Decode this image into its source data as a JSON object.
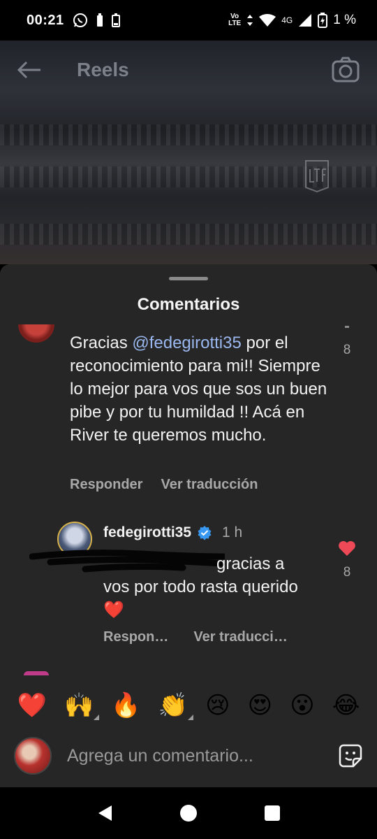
{
  "status_bar": {
    "time": "00:21",
    "network_top": "Vo",
    "network_bottom": "LTE",
    "signal_label": "4G",
    "battery_percent": "1 %"
  },
  "reels": {
    "title": "Reels"
  },
  "sheet": {
    "title": "Comentarios"
  },
  "comment": {
    "text_before_mention": "Gracias ",
    "mention": "@fedegirotti35",
    "text_after_mention": " por el reconocimiento para mi!! Siempre  lo mejor para vos que  sos un buen pibe y por tu humildad !! Acá en River te queremos mucho.",
    "like_count": "8",
    "reply_label": "Responder",
    "translate_label": "Ver traducción"
  },
  "reply": {
    "username": "fedegirotti35",
    "time": "1 h",
    "text_line1": "gracias a",
    "text_rest": "vos por todo rasta querido",
    "heart_emoji": "❤️",
    "like_count": "8",
    "reply_label": "Respon…",
    "translate_label": "Ver traducci…"
  },
  "emoji_bar": [
    "❤️",
    "🙌",
    "🔥",
    "👏",
    "😢",
    "😍",
    "😮",
    "😂"
  ],
  "input": {
    "placeholder": "Agrega un comentario..."
  },
  "colors": {
    "sheet_bg": "#262626",
    "mention": "#9ab8ef",
    "verified": "#3897f0",
    "like_heart": "#ed4956"
  }
}
